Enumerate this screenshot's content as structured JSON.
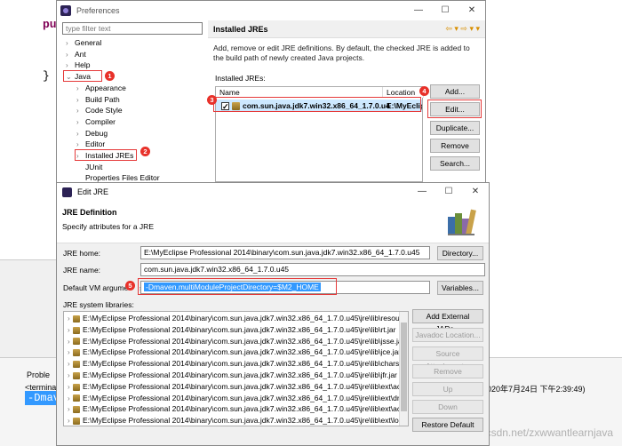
{
  "background": {
    "code_keyword": "pul",
    "closing_brace": "}",
    "problems_tab": "Proble",
    "console_terminated": "<terminat",
    "console_highlight": "-Dmav",
    "console_timestamp": "020年7月24日 下午2:39:49)",
    "watermark": "https://blog.csdn.net/zxwwantlearnjava"
  },
  "preferences": {
    "title": "Preferences",
    "filter_placeholder": "type filter text",
    "tree": [
      {
        "label": "General",
        "chev": "›"
      },
      {
        "label": "Ant",
        "chev": "›"
      },
      {
        "label": "Help",
        "chev": "›"
      },
      {
        "label": "Java",
        "chev": "⌄"
      },
      {
        "label": "Appearance",
        "chev": "›"
      },
      {
        "label": "Build Path",
        "chev": "›"
      },
      {
        "label": "Code Style",
        "chev": "›"
      },
      {
        "label": "Compiler",
        "chev": "›"
      },
      {
        "label": "Debug",
        "chev": "›"
      },
      {
        "label": "Editor",
        "chev": "›"
      },
      {
        "label": "Installed JREs",
        "chev": "›"
      },
      {
        "label": "JUnit",
        "chev": ""
      },
      {
        "label": "Properties Files Editor",
        "chev": ""
      }
    ],
    "page_title": "Installed JREs",
    "description": "Add, remove or edit JRE definitions. By default, the checked JRE is added to the build path of newly created Java projects.",
    "installed_label": "Installed JREs:",
    "table": {
      "col_name": "Name",
      "col_location": "Location",
      "row_name": "com.sun.java.jdk7.win32.x86_64_1.7.0.u4",
      "row_location": "E:\\MyEclip"
    },
    "buttons": {
      "add": "Add...",
      "edit": "Edit...",
      "duplicate": "Duplicate...",
      "remove": "Remove",
      "search": "Search..."
    },
    "badges": [
      "1",
      "2",
      "3",
      "4"
    ]
  },
  "edit_jre": {
    "title": "Edit JRE",
    "header_title": "JRE Definition",
    "header_subtitle": "Specify attributes for a JRE",
    "jre_home_label": "JRE home:",
    "jre_home_value": "E:\\MyEclipse Professional 2014\\binary\\com.sun.java.jdk7.win32.x86_64_1.7.0.u45",
    "jre_name_label": "JRE name:",
    "jre_name_value": "com.sun.java.jdk7.win32.x86_64_1.7.0.u45",
    "vm_args_label": "Default VM argume",
    "vm_args_label_tail": "s:",
    "vm_args_value": "-Dmaven.multiModuleProjectDirectory=$M2_HOME",
    "libs_label": "JRE system libraries:",
    "libraries": [
      "E:\\MyEclipse Professional 2014\\binary\\com.sun.java.jdk7.win32.x86_64_1.7.0.u45\\jre\\lib\\resourc",
      "E:\\MyEclipse Professional 2014\\binary\\com.sun.java.jdk7.win32.x86_64_1.7.0.u45\\jre\\lib\\rt.jar",
      "E:\\MyEclipse Professional 2014\\binary\\com.sun.java.jdk7.win32.x86_64_1.7.0.u45\\jre\\lib\\jsse.jar",
      "E:\\MyEclipse Professional 2014\\binary\\com.sun.java.jdk7.win32.x86_64_1.7.0.u45\\jre\\lib\\jce.jar",
      "E:\\MyEclipse Professional 2014\\binary\\com.sun.java.jdk7.win32.x86_64_1.7.0.u45\\jre\\lib\\charsets",
      "E:\\MyEclipse Professional 2014\\binary\\com.sun.java.jdk7.win32.x86_64_1.7.0.u45\\jre\\lib\\jfr.jar",
      "E:\\MyEclipse Professional 2014\\binary\\com.sun.java.jdk7.win32.x86_64_1.7.0.u45\\jre\\lib\\ext\\acce",
      "E:\\MyEclipse Professional 2014\\binary\\com.sun.java.jdk7.win32.x86_64_1.7.0.u45\\jre\\lib\\ext\\dnsi",
      "E:\\MyEclipse Professional 2014\\binary\\com.sun.java.jdk7.win32.x86_64_1.7.0.u45\\jre\\lib\\ext\\acce",
      "E:\\MyEclipse Professional 2014\\binary\\com.sun.java.jdk7.win32.x86_64_1.7.0.u45\\jre\\lib\\ext\\loca"
    ],
    "buttons": {
      "directory": "Directory...",
      "variables": "Variables...",
      "add_external": "Add External JARs...",
      "javadoc": "Javadoc Location...",
      "source": "Source Attachment...",
      "remove": "Remove",
      "up": "Up",
      "down": "Down",
      "restore": "Restore Default"
    },
    "badge": "5"
  },
  "colors": {
    "annotation_red": "#e53a3a",
    "selection_blue": "#3399ff"
  }
}
